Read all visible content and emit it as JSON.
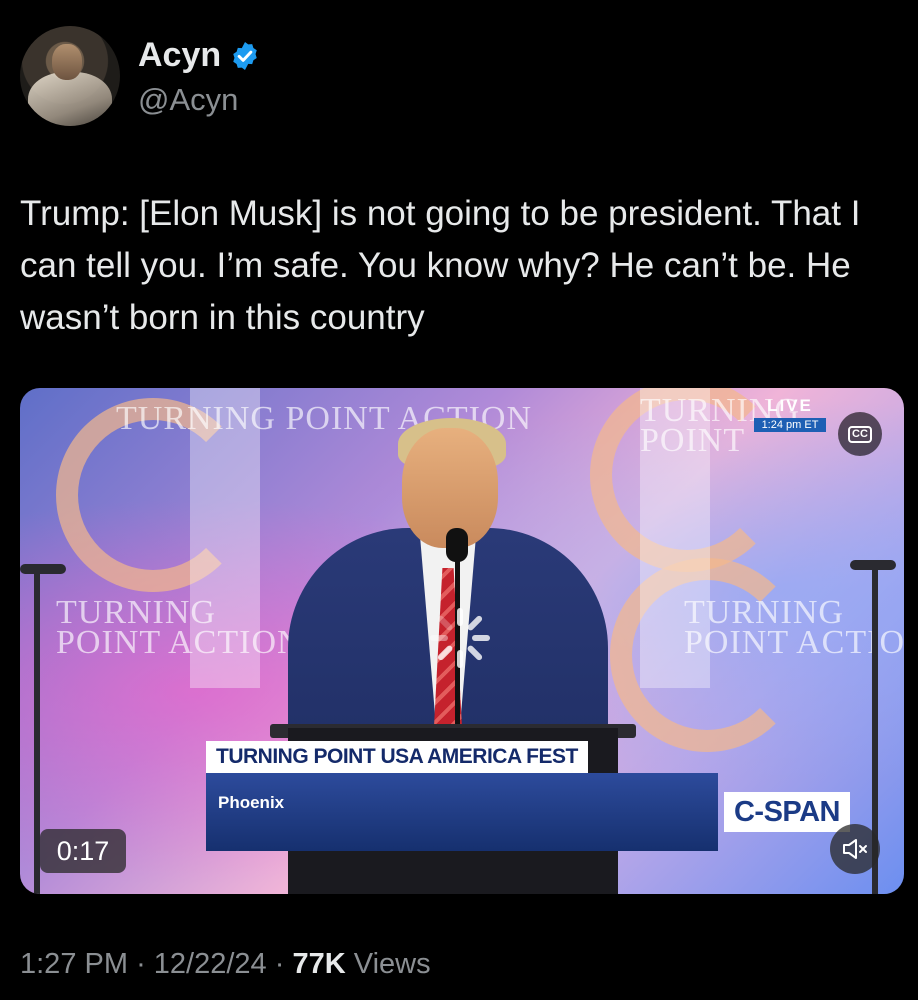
{
  "author": {
    "display_name": "Acyn",
    "handle": "@Acyn",
    "verified": true
  },
  "tweet": {
    "text": "Trump: [Elon Musk] is not going to be president. That I can tell you. I’m safe. You know why? He can’t be. He wasn’t born in this country"
  },
  "video": {
    "background_logos": [
      "TURNING POINT ACTION",
      "TURNING POINT ACTION",
      "TURNING POINT",
      "TURNING POINT ACTIO"
    ],
    "live_label": "LIVE",
    "live_time": "1:24 pm ET",
    "cc_label": "CC",
    "lower_third_title": "TURNING POINT USA AMERICA FEST",
    "lower_third_location": "Phoenix",
    "network": "C-SPAN",
    "elapsed": "0:17",
    "muted": true
  },
  "meta": {
    "time": "1:27 PM",
    "separator": "·",
    "date": "12/22/24",
    "views_count": "77K",
    "views_label": "Views"
  },
  "colors": {
    "background": "#000000",
    "text": "#e7e9ea",
    "secondary_text": "#8b8f93",
    "verified_blue": "#1d9bf0"
  }
}
